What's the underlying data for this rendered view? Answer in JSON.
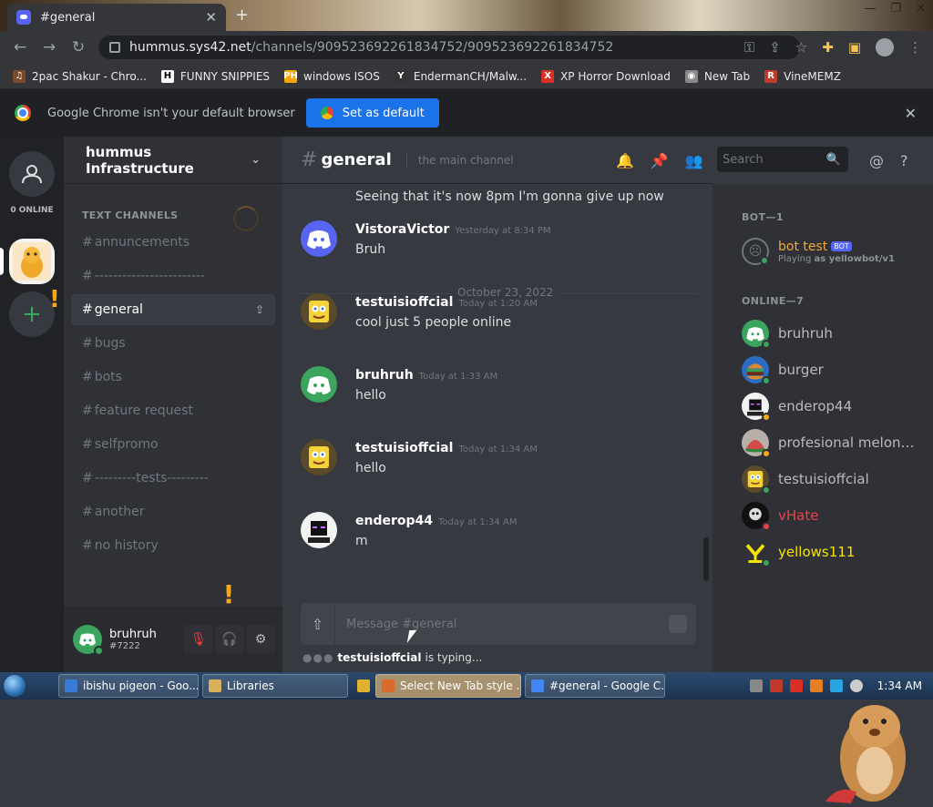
{
  "browser": {
    "tab_title": "#general",
    "url_host": "hummus.sys42.net",
    "url_path": "/channels/909523692261834752/909523692261834752",
    "bookmarks": [
      {
        "label": "2pac Shakur - Chro...",
        "color": "#7a4a2a",
        "glyph": "♫"
      },
      {
        "label": "FUNNY SNIPPIES",
        "color": "#ffffff",
        "glyph": "H"
      },
      {
        "label": "windows ISOS",
        "color": "#f7a600",
        "glyph": "PH"
      },
      {
        "label": "EndermanCH/Malw...",
        "color": "#333333",
        "glyph": "Y"
      },
      {
        "label": "XP Horror Download",
        "color": "#d93025",
        "glyph": "X"
      },
      {
        "label": "New Tab",
        "color": "#888888",
        "glyph": "◉"
      },
      {
        "label": "VineMEMZ",
        "color": "#c0392b",
        "glyph": "R"
      }
    ],
    "notice_text": "Google Chrome isn't your default browser",
    "set_default_label": "Set as default"
  },
  "servers": {
    "online_label": "0 ONLINE"
  },
  "sidebar": {
    "guild_name": "hummus Infrastructure",
    "category": "TEXT CHANNELS",
    "channels": [
      {
        "name": "annuncements",
        "active": false
      },
      {
        "name": "------------------------",
        "active": false
      },
      {
        "name": "general",
        "active": true
      },
      {
        "name": "bugs",
        "active": false
      },
      {
        "name": "bots",
        "active": false
      },
      {
        "name": "feature request",
        "active": false
      },
      {
        "name": "selfpromo",
        "active": false
      },
      {
        "name": "---------tests---------",
        "active": false
      },
      {
        "name": "another",
        "active": false
      },
      {
        "name": "no history",
        "active": false
      }
    ]
  },
  "user": {
    "name": "bruhruh",
    "tag": "#7222"
  },
  "channel": {
    "hash": "#",
    "name": "general",
    "topic": "the main channel",
    "search_placeholder": "Search"
  },
  "messages": {
    "continued_text": "Seeing that it's now 8pm I'm gonna give up now",
    "divider_label": "October 23, 2022",
    "items": [
      {
        "author": "VistoraVictor",
        "time": "Yesterday at 8:34 PM",
        "text": "Bruh",
        "avatar": "discord"
      },
      {
        "author": "testuisioffcial",
        "time": "Today at 1:20 AM",
        "text": "cool just 5 people online",
        "avatar": "sponge"
      },
      {
        "author": "bruhruh",
        "time": "Today at 1:33 AM",
        "text": "hello",
        "avatar": "discord-green"
      },
      {
        "author": "testuisioffcial",
        "time": "Today at 1:34 AM",
        "text": "hello",
        "avatar": "sponge"
      },
      {
        "author": "enderop44",
        "time": "Today at 1:34 AM",
        "text": "m",
        "avatar": "ender"
      }
    ]
  },
  "composer": {
    "placeholder": "Message #general",
    "typing_user": "testuisioffcial",
    "typing_suffix": "is typing..."
  },
  "members": {
    "bot_section": "BOT—1",
    "online_section": "ONLINE—7",
    "bot": {
      "name": "bot test",
      "badge": "BOT",
      "activity_prefix": "Playing",
      "activity": "as yellowbot/v1",
      "name_color": "#f0a83a"
    },
    "online": [
      {
        "name": "bruhruh",
        "color": "#b9bbbe",
        "status": "#3ba55d",
        "avatar": "discord-green"
      },
      {
        "name": "burger",
        "color": "#b9bbbe",
        "status": "#3ba55d",
        "avatar": "burger"
      },
      {
        "name": "enderop44",
        "color": "#b9bbbe",
        "status": "#faa81a",
        "avatar": "ender"
      },
      {
        "name": "profesional melon ...",
        "color": "#b9bbbe",
        "status": "#faa81a",
        "avatar": "melon"
      },
      {
        "name": "testuisioffcial",
        "color": "#b9bbbe",
        "status": "#3ba55d",
        "avatar": "sponge"
      },
      {
        "name": "vHate",
        "color": "#ed4245",
        "status": "#ed4245",
        "avatar": "vhate"
      },
      {
        "name": "yellows111",
        "color": "#f5e400",
        "status": "#3ba55d",
        "avatar": "yellow"
      }
    ]
  },
  "taskbar": {
    "items": [
      {
        "label": "ibishu pigeon - Goo...",
        "active": false,
        "icon_color": "#3a7bd5"
      },
      {
        "label": "Libraries",
        "active": false,
        "icon_color": "#d9b15c"
      },
      {
        "label": "",
        "active": false,
        "icon_color": "#e0b030"
      },
      {
        "label": "Select New Tab style ...",
        "active": true,
        "icon_color": "#d96b2a"
      },
      {
        "label": "#general - Google C...",
        "active": false,
        "icon_color": "#4285f4"
      }
    ],
    "clock": "1:34 AM"
  }
}
